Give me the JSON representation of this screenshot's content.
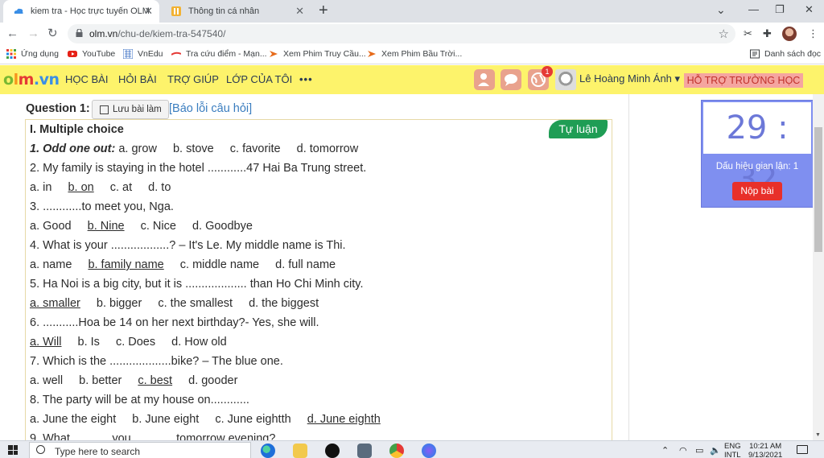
{
  "browser": {
    "tabs": [
      {
        "title": "kiem tra - Học trực tuyến OLM",
        "active": true
      },
      {
        "title": "Thông tin cá nhân",
        "active": false
      }
    ],
    "url_domain": "olm.vn",
    "url_path": "/chu-de/kiem-tra-547540/",
    "bookmarks": [
      {
        "label": "Ứng dụng",
        "icon": "apps-grid-icon"
      },
      {
        "label": "YouTube",
        "icon": "youtube-icon"
      },
      {
        "label": "VnEdu",
        "icon": "vnedu-icon"
      },
      {
        "label": "Tra cứu điểm - Mạn...",
        "icon": "score-icon"
      },
      {
        "label": "Xem Phim Truy Cầu...",
        "icon": "film-icon"
      },
      {
        "label": "Xem Phim Bầu Trời...",
        "icon": "film-icon"
      }
    ],
    "reading_list": "Danh sách đọc"
  },
  "site": {
    "logo": "olm.vn",
    "nav": [
      "HỌC BÀI",
      "HỎI BÀI",
      "TRỢ GIÚP",
      "LỚP CỦA TÔI",
      "•••"
    ],
    "notification_count": "1",
    "user_name": "Lê Hoàng Minh Ánh",
    "support_label": "HỖ TRỢ TRƯỜNG HỌC"
  },
  "question": {
    "heading": "Question 1:",
    "save_label": "Lưu bài làm",
    "report_label": "[Báo lỗi câu hỏi]",
    "type_badge": "Tự luận",
    "section": "I. Multiple choice",
    "lines": [
      "1. Odd one out:",
      "2. My family is staying in the hotel ............47 Hai Ba Trung street.",
      "3. ............to meet you, Nga.",
      "4. What is your ..................? – It's Le. My middle name is Thi.",
      "5. Ha Noi is a big city, but it is ................... than Ho Chi Minh city.",
      "6. ...........Hoa be 14 on her next birthday?- Yes, she will.",
      "7. Which is the ...................bike? – The blue one.",
      "8. The party will be at my house on............",
      "9. What ............you .............tomorrow evening?"
    ],
    "q1_options": [
      "a. grow",
      "b. stove",
      "c. favorite",
      "d. tomorrow"
    ],
    "q2_options": [
      "a. in",
      "b. on",
      "c. at",
      "d. to"
    ],
    "q3_options": [
      "a. Good",
      "b. Nine",
      "c. Nice",
      "d. Goodbye"
    ],
    "q4_options": [
      "a. name",
      "b. family name",
      "c. middle name",
      "d. full name"
    ],
    "q5_options": [
      "a. smaller",
      "b. bigger",
      "c. the smallest",
      "d. the biggest"
    ],
    "q6_options": [
      "a. Will",
      "b. Is",
      "c. Does",
      "d. How old"
    ],
    "q7_options": [
      "a. well",
      "b. better",
      "c. best",
      "d. gooder"
    ],
    "q8_options": [
      "a. June the eight",
      "b. June eight",
      "c. June eightth",
      "d. June eighth"
    ]
  },
  "timer": {
    "time": "29 : 32",
    "cheat_label": "Dấu hiệu gian lận: 1",
    "submit_label": "Nộp bài"
  },
  "taskbar": {
    "search_placeholder": "Type here to search",
    "lang": "ENG",
    "lang2": "INTL",
    "time": "10:21 AM",
    "date": "9/13/2021"
  }
}
